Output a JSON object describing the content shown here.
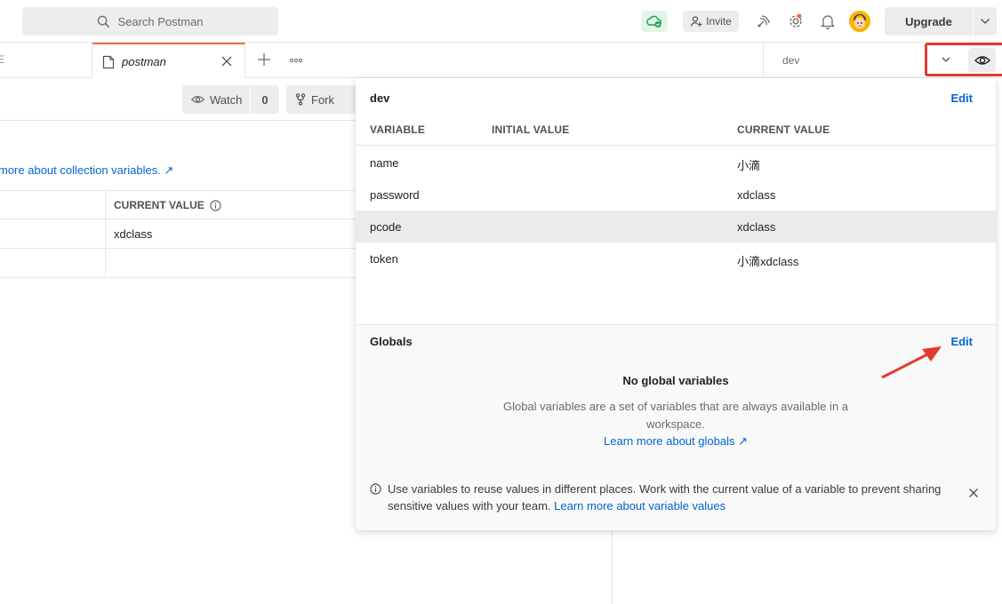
{
  "header": {
    "search_placeholder": "Search Postman",
    "invite_label": "Invite",
    "upgrade_label": "Upgrade"
  },
  "tabs": {
    "previous_tab_fragment": "E",
    "active_tab_label": "postman"
  },
  "environment_selector": {
    "selected": "dev"
  },
  "collection": {
    "watch_label": "Watch",
    "watch_count": "0",
    "fork_label": "Fork",
    "learn_more": "more about collection variables. ↗",
    "table_header": "CURRENT VALUE",
    "rows": [
      "xdclass",
      ""
    ]
  },
  "env_popover": {
    "title": "dev",
    "edit_label": "Edit",
    "columns": [
      "VARIABLE",
      "INITIAL VALUE",
      "CURRENT VALUE"
    ],
    "rows": [
      {
        "variable": "name",
        "initial": "",
        "current": "小滴"
      },
      {
        "variable": "password",
        "initial": "",
        "current": "xdclass"
      },
      {
        "variable": "pcode",
        "initial": "",
        "current": "xdclass"
      },
      {
        "variable": "token",
        "initial": "",
        "current": "小滴xdclass"
      }
    ]
  },
  "globals": {
    "title": "Globals",
    "edit_label": "Edit",
    "empty_title": "No global variables",
    "empty_desc": "Global variables are a set of variables that are always available in a workspace.",
    "learn_link": "Learn more about globals ↗"
  },
  "info_banner": {
    "text": "Use variables to reuse values in different places. Work with the current value of a variable to prevent sharing sensitive values with your team.",
    "link": "Learn more about variable values"
  },
  "colors": {
    "accent_orange": "#f26b3a",
    "link_blue": "#0265d2",
    "annotation_red": "#e03c31"
  }
}
